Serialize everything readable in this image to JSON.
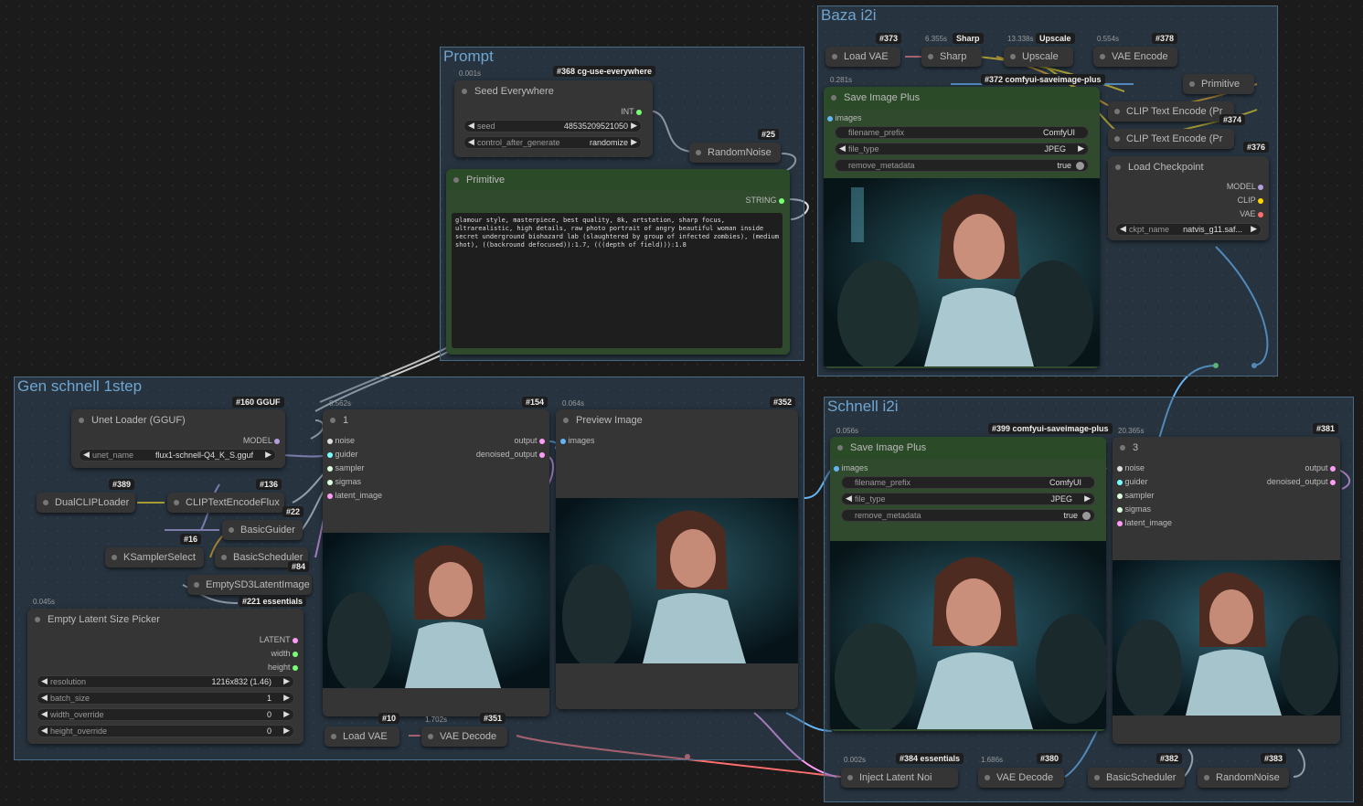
{
  "groups": {
    "prompt": "Prompt",
    "baza": "Baza i2i",
    "gen": "Gen schnell 1step",
    "schnell": "Schnell i2i"
  },
  "nodes": {
    "seed_everywhere": {
      "title": "Seed Everywhere",
      "tag": "#368 cg-use-everywhere",
      "timing": "0.001s",
      "out": "INT",
      "seed_label": "seed",
      "seed_value": "48535209521050",
      "cag_label": "control_after_generate",
      "cag_value": "randomize"
    },
    "random_noise_25": {
      "title": "RandomNoise",
      "tag": "#25"
    },
    "primitive_prompt": {
      "title": "Primitive",
      "out": "STRING",
      "text": "glamour style, masterpiece, best quality, 8k, artstation, sharp focus, ultrarealistic, high details, raw photo portrait of angry beautiful woman inside secret underground biohazard lab (slaughtered by group of infected zombies), (medium shot), ((backround defocused)):1.7, (((depth of field))):1.8"
    },
    "load_vae_top": {
      "title": "Load VAE",
      "tag": "#373"
    },
    "sharp": {
      "title": "Sharp",
      "tag": "Sharp",
      "timing": "6.355s"
    },
    "upscale": {
      "title": "Upscale",
      "tag": "Upscale",
      "timing": "13.338s"
    },
    "vae_encode": {
      "title": "VAE Encode",
      "tag": "#378",
      "timing": "0.554s"
    },
    "primitive_small": {
      "title": "Primitive"
    },
    "clip1": {
      "title": "CLIP Text Encode (Pr",
      "tag": "#374"
    },
    "clip2": {
      "title": "CLIP Text Encode (Pr",
      "tag": "#376"
    },
    "load_ckpt": {
      "title": "Load Checkpoint",
      "o1": "MODEL",
      "o2": "CLIP",
      "o3": "VAE",
      "ckpt_label": "ckpt_name",
      "ckpt_value": "natvis_g11.saf..."
    },
    "save_top": {
      "title": "Save Image Plus",
      "tag": "#372 comfyui-saveimage-plus",
      "timing": "0.281s",
      "in": "images",
      "w1l": "filename_prefix",
      "w1v": "ComfyUI",
      "w2l": "file_type",
      "w2v": "JPEG",
      "w3l": "remove_metadata",
      "w3v": "true"
    },
    "unet": {
      "title": "Unet Loader (GGUF)",
      "tag": "#160 GGUF",
      "out": "MODEL",
      "wl": "unet_name",
      "wv": "flux1-schnell-Q4_K_S.gguf"
    },
    "dualclip": {
      "title": "DualCLIPLoader",
      "tag": "#389"
    },
    "clipflux": {
      "title": "CLIPTextEncodeFlux",
      "tag": "#136",
      "tag2": "#22"
    },
    "basicguider": {
      "title": "BasicGuider",
      "tag": "#16"
    },
    "ksamplersel": {
      "title": "KSamplerSelect"
    },
    "basicsched": {
      "title": "BasicScheduler",
      "tag": "#84",
      "timing": "0.002s"
    },
    "emptysd3": {
      "title": "EmptySD3LatentImage",
      "tag": "#221 essentials"
    },
    "latentpicker": {
      "title": "Empty Latent Size Picker",
      "timing": "0.045s",
      "o1": "LATENT",
      "o2": "width",
      "o3": "height",
      "r_l": "resolution",
      "r_v": "1216x832 (1.46)",
      "b_l": "batch_size",
      "b_v": "1",
      "w_l": "width_override",
      "w_v": "0",
      "h_l": "height_override",
      "h_v": "0"
    },
    "sampler1": {
      "title": "1",
      "tag": "#154",
      "timing": "8.562s",
      "i1": "noise",
      "i2": "guider",
      "i3": "sampler",
      "i4": "sigmas",
      "i5": "latent_image",
      "o1": "output",
      "o2": "denoised_output"
    },
    "preview": {
      "title": "Preview Image",
      "tag": "#352",
      "timing": "0.064s",
      "in": "images"
    },
    "load_vae_bot": {
      "title": "Load VAE",
      "tag": "#10"
    },
    "vae_decode_bot": {
      "title": "VAE Decode",
      "tag": "#351",
      "timing": "1.702s"
    },
    "save_bot": {
      "title": "Save Image Plus",
      "tag": "#399 comfyui-saveimage-plus",
      "timing": "0.056s",
      "in": "images",
      "w1l": "filename_prefix",
      "w1v": "ComfyUI",
      "w2l": "file_type",
      "w2v": "JPEG",
      "w3l": "remove_metadata",
      "w3v": "true"
    },
    "sampler3": {
      "title": "3",
      "tag": "#381",
      "timing": "20.365s",
      "i1": "noise",
      "i2": "guider",
      "i3": "sampler",
      "i4": "sigmas",
      "i5": "latent_image",
      "o1": "output",
      "o2": "denoised_output"
    },
    "inject": {
      "title": "Inject Latent Noi",
      "tag": "#384 essentials",
      "timing": "0.002s"
    },
    "vae_decode_r": {
      "title": "VAE Decode",
      "tag": "#380",
      "timing": "1.686s"
    },
    "basicsched_r": {
      "title": "BasicScheduler",
      "tag": "#382"
    },
    "randomnoise_r": {
      "title": "RandomNoise",
      "tag": "#383"
    }
  },
  "colors": {
    "model": "#b39ddb",
    "clip": "#ffd500",
    "vae": "#ff6e6e",
    "latent": "#ff9cf9",
    "image": "#64b5f6",
    "int": "#7f7",
    "string": "#7f7"
  }
}
